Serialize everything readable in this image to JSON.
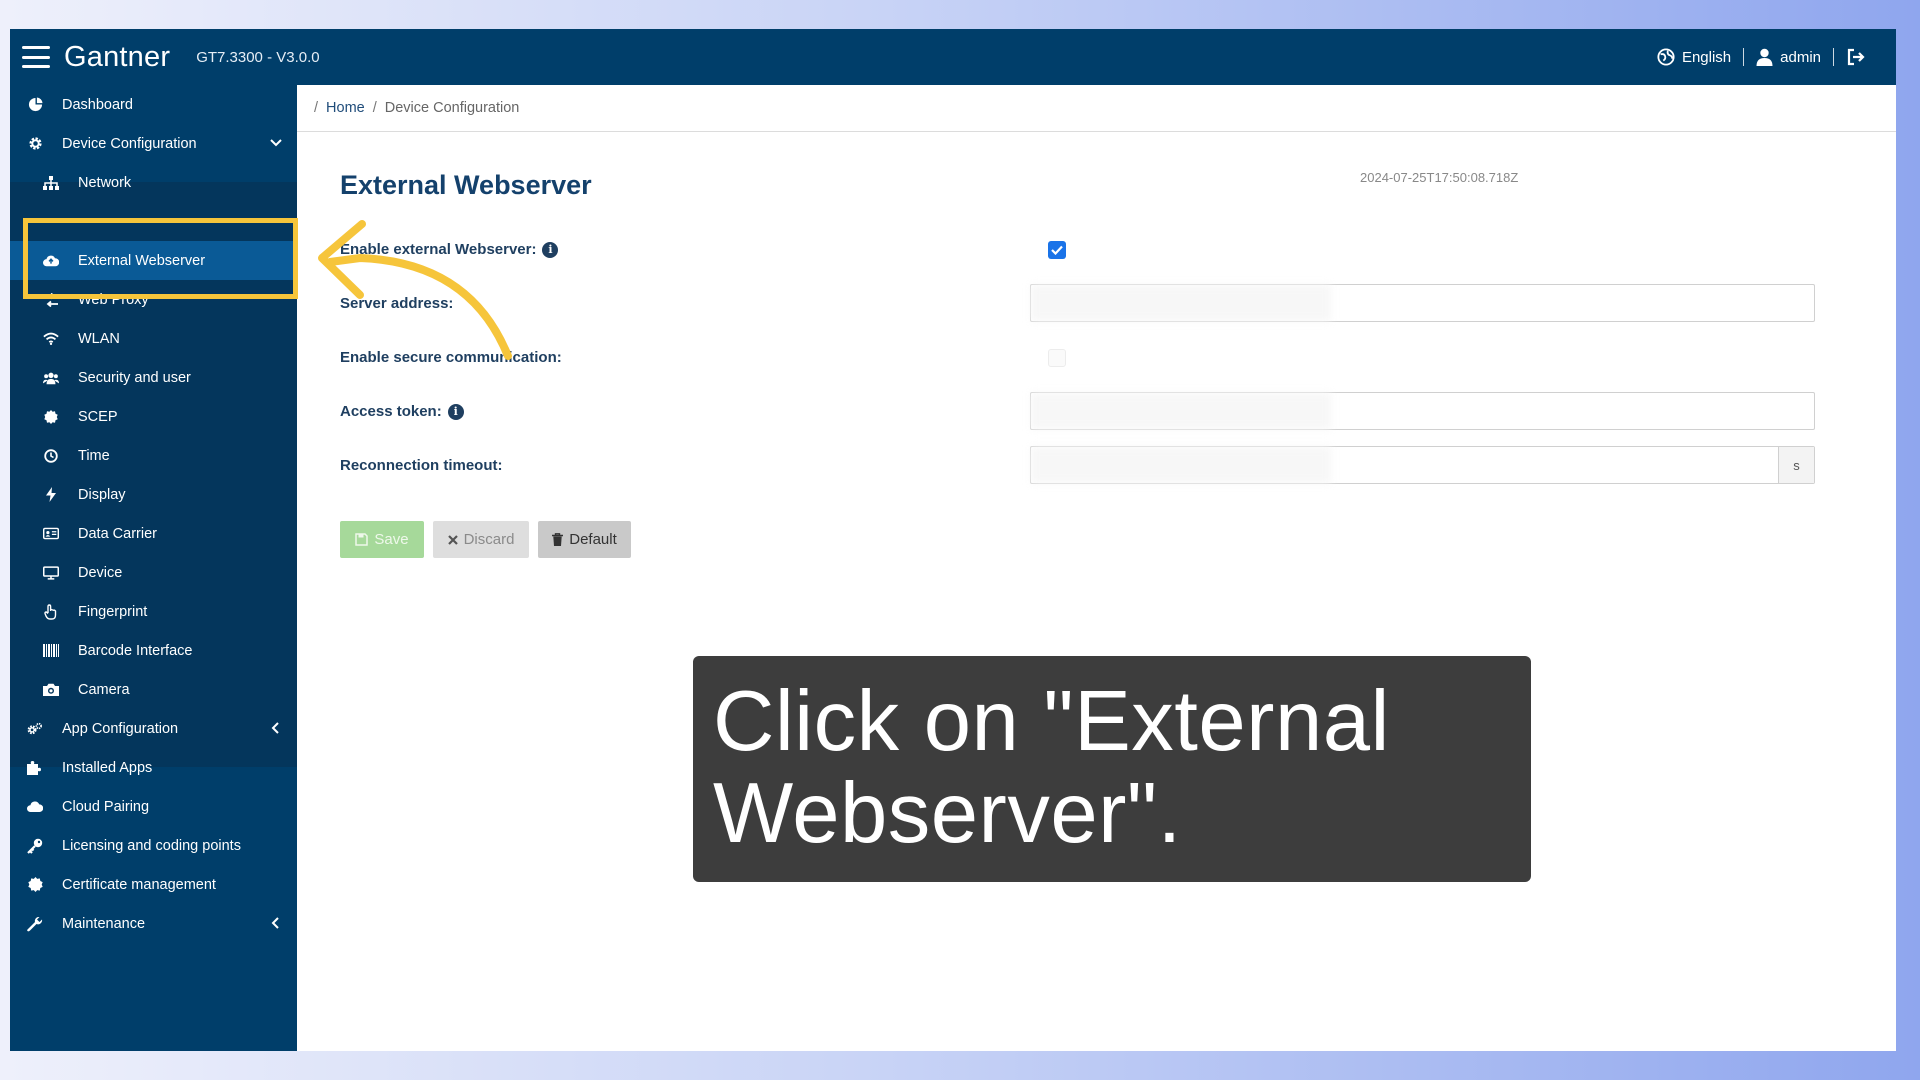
{
  "topbar": {
    "logo": "Gantner",
    "version": "GT7.3300 - V3.0.0",
    "language": "English",
    "user": "admin"
  },
  "sidebar": {
    "items": [
      {
        "label": "Dashboard",
        "icon": "dashboard-icon"
      },
      {
        "label": "Device Configuration",
        "icon": "gear-icon"
      },
      {
        "label": "Network",
        "icon": "network-icon"
      },
      {
        "label": "External Webserver",
        "icon": "cloud-icon"
      },
      {
        "label": "Web Proxy",
        "icon": "proxy-icon"
      },
      {
        "label": "WLAN",
        "icon": "wifi-icon"
      },
      {
        "label": "Security and user",
        "icon": "users-icon"
      },
      {
        "label": "SCEP",
        "icon": "badge-icon"
      },
      {
        "label": "Time",
        "icon": "clock-icon"
      },
      {
        "label": "Display",
        "icon": "bolt-icon"
      },
      {
        "label": "Data Carrier",
        "icon": "card-icon"
      },
      {
        "label": "Device",
        "icon": "monitor-icon"
      },
      {
        "label": "Fingerprint",
        "icon": "fingerprint-icon"
      },
      {
        "label": "Barcode Interface",
        "icon": "barcode-icon"
      },
      {
        "label": "Camera",
        "icon": "camera-icon"
      },
      {
        "label": "App Configuration",
        "icon": "gears-icon"
      },
      {
        "label": "Installed Apps",
        "icon": "puzzle-icon"
      },
      {
        "label": "Cloud Pairing",
        "icon": "cloud-icon"
      },
      {
        "label": "Licensing and coding points",
        "icon": "key-icon"
      },
      {
        "label": "Certificate management",
        "icon": "certificate-icon"
      },
      {
        "label": "Maintenance",
        "icon": "wrench-icon"
      }
    ]
  },
  "breadcrumb": {
    "home": "Home",
    "current": "Device Configuration"
  },
  "main": {
    "title": "External Webserver",
    "timestamp": "2024-07-25T17:50:08.718Z",
    "labels": {
      "enable_webserver": "Enable external Webserver:",
      "server_address": "Server address:",
      "secure_communication": "Enable secure communication:",
      "access_token": "Access token:",
      "reconnection_timeout": "Reconnection timeout:"
    },
    "timeout_unit": "s",
    "buttons": {
      "save": "Save",
      "discard": "Discard",
      "default": "Default"
    }
  },
  "overlay": {
    "line1": "Click on \"External",
    "line2": "Webserver\"."
  },
  "colors": {
    "navy": "#003e6a",
    "active": "#0a5a96",
    "highlight": "#f6c53b",
    "save_green": "#a6d99a",
    "checkbox_blue": "#1a73e8"
  }
}
